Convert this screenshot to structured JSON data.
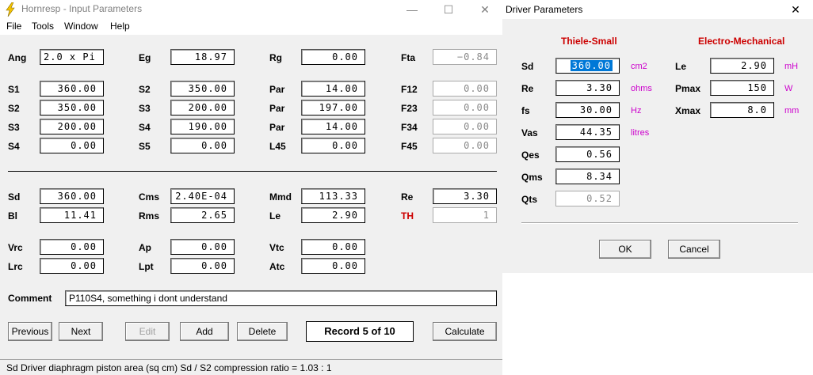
{
  "main_window": {
    "title": "Hornresp - Input Parameters",
    "controls": {
      "minimize": "—",
      "maximize": "☐",
      "close": "✕"
    },
    "menu": [
      "File",
      "Tools",
      "Window",
      "Help"
    ],
    "labels": {
      "ang": "Ang",
      "eg": "Eg",
      "rg": "Rg",
      "fta": "Fta",
      "s1": "S1",
      "s2a": "S2",
      "par1": "Par",
      "f12": "F12",
      "s2b": "S2",
      "s3a": "S3",
      "par2": "Par",
      "f23": "F23",
      "s3b": "S3",
      "s4a": "S4",
      "par3": "Par",
      "f34": "F34",
      "s4b": "S4",
      "s5": "S5",
      "l45": "L45",
      "f45": "F45",
      "sd": "Sd",
      "cms": "Cms",
      "mmd": "Mmd",
      "re": "Re",
      "bl": "Bl",
      "rms": "Rms",
      "le": "Le",
      "th": "TH",
      "vrc": "Vrc",
      "ap": "Ap",
      "vtc": "Vtc",
      "lrc": "Lrc",
      "lpt": "Lpt",
      "atc": "Atc",
      "comment": "Comment"
    },
    "values": {
      "ang": "2.0 x Pi",
      "eg": "18.97",
      "rg": "0.00",
      "fta": "−0.84",
      "s1": "360.00",
      "s2a": "350.00",
      "par1": "14.00",
      "f12": "0.00",
      "s2b": "350.00",
      "s3a": "200.00",
      "par2": "197.00",
      "f23": "0.00",
      "s3b": "200.00",
      "s4a": "190.00",
      "par3": "14.00",
      "f34": "0.00",
      "s4b": "0.00",
      "s5": "0.00",
      "l45": "0.00",
      "f45": "0.00",
      "sd": "360.00",
      "cms": "2.40E-04",
      "mmd": "113.33",
      "re": "3.30",
      "bl": "11.41",
      "rms": "2.65",
      "le": "2.90",
      "th": "1",
      "vrc": "0.00",
      "ap": "0.00",
      "vtc": "0.00",
      "lrc": "0.00",
      "lpt": "0.00",
      "atc": "0.00",
      "comment": "P110S4, something i dont understand"
    },
    "buttons": {
      "previous": "Previous",
      "next": "Next",
      "edit": "Edit",
      "add": "Add",
      "delete": "Delete",
      "calculate": "Calculate"
    },
    "record": "Record 5 of 10",
    "status": "Sd   Driver diaphragm piston area  (sq cm)   Sd / S2 compression ratio = 1.03 : 1"
  },
  "driver_dialog": {
    "title": "Driver Parameters",
    "close": "✕",
    "groups": {
      "thiele_small": "Thiele-Small",
      "electro_mechanical": "Electro-Mechanical"
    },
    "ts_params": [
      {
        "label": "Sd",
        "value": "360.00",
        "unit": "cm2"
      },
      {
        "label": "Re",
        "value": "3.30",
        "unit": "ohms"
      },
      {
        "label": "fs",
        "value": "30.00",
        "unit": "Hz"
      },
      {
        "label": "Vas",
        "value": "44.35",
        "unit": "litres"
      },
      {
        "label": "Qes",
        "value": "0.56",
        "unit": ""
      },
      {
        "label": "Qms",
        "value": "8.34",
        "unit": ""
      },
      {
        "label": "Qts",
        "value": "0.52",
        "unit": ""
      }
    ],
    "em_params": [
      {
        "label": "Le",
        "value": "2.90",
        "unit": "mH"
      },
      {
        "label": "Pmax",
        "value": "150",
        "unit": "W"
      },
      {
        "label": "Xmax",
        "value": "8.0",
        "unit": "mm"
      }
    ],
    "buttons": {
      "ok": "OK",
      "cancel": "Cancel"
    }
  },
  "colors": {
    "accent_red": "#cc0000",
    "unit_magenta": "#cc00cc",
    "selection_blue": "#0078d7"
  }
}
